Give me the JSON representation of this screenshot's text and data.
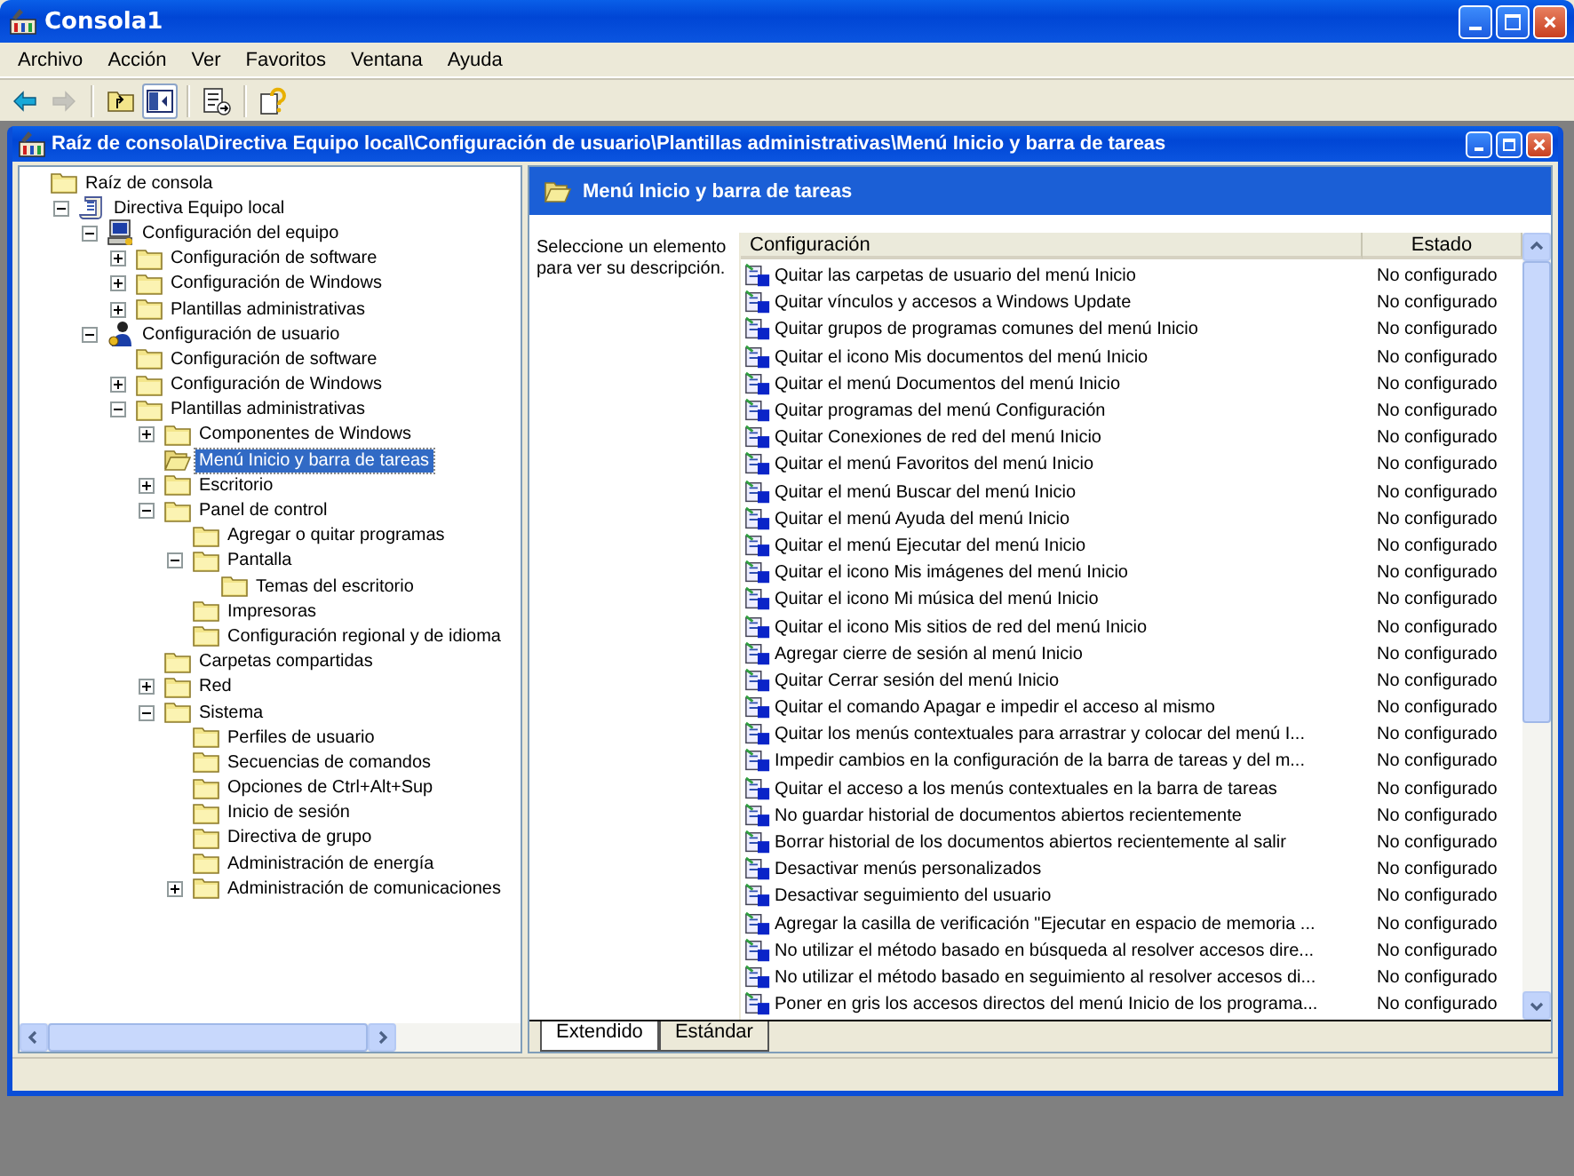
{
  "window": {
    "title": "Consola1"
  },
  "menu": [
    "Archivo",
    "Acción",
    "Ver",
    "Favoritos",
    "Ventana",
    "Ayuda"
  ],
  "toolbar": [
    {
      "kind": "back",
      "disabled": false,
      "pressed": false
    },
    {
      "kind": "forward",
      "disabled": true,
      "pressed": false
    },
    {
      "kind": "up",
      "disabled": false,
      "pressed": false
    },
    {
      "kind": "tree",
      "disabled": false,
      "pressed": true
    },
    {
      "kind": "export",
      "disabled": false,
      "pressed": false
    },
    {
      "kind": "help",
      "disabled": false,
      "pressed": false
    }
  ],
  "console": {
    "title": "Raíz de consola\\Directiva Equipo local\\Configuración de usuario\\Plantillas administrativas\\Menú Inicio y barra de tareas",
    "tree": [
      {
        "label": "Raíz de consola",
        "kind": "folder",
        "selected": false,
        "children": [
          {
            "label": "Directiva Equipo local",
            "kind": "policy",
            "expanded": true,
            "selected": false,
            "children": [
              {
                "label": "Configuración del equipo",
                "kind": "computer",
                "expanded": true,
                "selected": false,
                "children": [
                  {
                    "label": "Configuración de software",
                    "kind": "folder",
                    "expanded": false,
                    "selected": false
                  },
                  {
                    "label": "Configuración de Windows",
                    "kind": "folder",
                    "expanded": false,
                    "selected": false
                  },
                  {
                    "label": "Plantillas administrativas",
                    "kind": "folder",
                    "expanded": false,
                    "selected": false
                  }
                ]
              },
              {
                "label": "Configuración de usuario",
                "kind": "user",
                "expanded": true,
                "selected": false,
                "children": [
                  {
                    "label": "Configuración de software",
                    "kind": "folder",
                    "selected": false
                  },
                  {
                    "label": "Configuración de Windows",
                    "kind": "folder",
                    "expanded": false,
                    "selected": false
                  },
                  {
                    "label": "Plantillas administrativas",
                    "kind": "folder",
                    "expanded": true,
                    "selected": false,
                    "children": [
                      {
                        "label": "Componentes de Windows",
                        "kind": "folder",
                        "expanded": false,
                        "selected": false
                      },
                      {
                        "label": "Menú Inicio y barra de tareas",
                        "kind": "folder",
                        "selected": true
                      },
                      {
                        "label": "Escritorio",
                        "kind": "folder",
                        "expanded": false,
                        "selected": false
                      },
                      {
                        "label": "Panel de control",
                        "kind": "folder",
                        "expanded": true,
                        "selected": false,
                        "children": [
                          {
                            "label": "Agregar o quitar programas",
                            "kind": "folder",
                            "selected": false
                          },
                          {
                            "label": "Pantalla",
                            "kind": "folder",
                            "expanded": true,
                            "selected": false,
                            "children": [
                              {
                                "label": "Temas del escritorio",
                                "kind": "folder",
                                "selected": false
                              }
                            ]
                          },
                          {
                            "label": "Impresoras",
                            "kind": "folder",
                            "selected": false
                          },
                          {
                            "label": "Configuración regional y de idioma",
                            "kind": "folder",
                            "selected": false
                          }
                        ]
                      },
                      {
                        "label": "Carpetas compartidas",
                        "kind": "folder",
                        "selected": false
                      },
                      {
                        "label": "Red",
                        "kind": "folder",
                        "expanded": false,
                        "selected": false
                      },
                      {
                        "label": "Sistema",
                        "kind": "folder",
                        "expanded": true,
                        "selected": false,
                        "children": [
                          {
                            "label": "Perfiles de usuario",
                            "kind": "folder",
                            "selected": false
                          },
                          {
                            "label": "Secuencias de comandos",
                            "kind": "folder",
                            "selected": false
                          },
                          {
                            "label": "Opciones de Ctrl+Alt+Sup",
                            "kind": "folder",
                            "selected": false
                          },
                          {
                            "label": "Inicio de sesión",
                            "kind": "folder",
                            "selected": false
                          },
                          {
                            "label": "Directiva de grupo",
                            "kind": "folder",
                            "selected": false
                          },
                          {
                            "label": "Administración de energía",
                            "kind": "folder",
                            "selected": false
                          },
                          {
                            "label": "Administración de comunicaciones",
                            "kind": "folder",
                            "expanded": false,
                            "selected": false
                          }
                        ]
                      }
                    ]
                  }
                ]
              }
            ]
          }
        ]
      }
    ],
    "panel": {
      "title": "Menú Inicio y barra de tareas",
      "description": "Seleccione un elemento para ver su descripción.",
      "columns": [
        "Configuración",
        "Estado"
      ],
      "rows": [
        {
          "setting": "Quitar las carpetas de usuario del menú Inicio",
          "state": "No configurado"
        },
        {
          "setting": "Quitar vínculos y accesos a Windows Update",
          "state": "No configurado"
        },
        {
          "setting": "Quitar grupos de programas comunes del menú Inicio",
          "state": "No configurado"
        },
        {
          "setting": "Quitar el icono Mis documentos del menú Inicio",
          "state": "No configurado"
        },
        {
          "setting": "Quitar el menú Documentos del menú Inicio",
          "state": "No configurado"
        },
        {
          "setting": "Quitar programas del menú Configuración",
          "state": "No configurado"
        },
        {
          "setting": "Quitar Conexiones de red del menú Inicio",
          "state": "No configurado"
        },
        {
          "setting": "Quitar el menú Favoritos del menú Inicio",
          "state": "No configurado"
        },
        {
          "setting": "Quitar el menú Buscar del menú Inicio",
          "state": "No configurado"
        },
        {
          "setting": "Quitar el menú Ayuda del menú Inicio",
          "state": "No configurado"
        },
        {
          "setting": "Quitar el menú Ejecutar del menú Inicio",
          "state": "No configurado"
        },
        {
          "setting": "Quitar el icono Mis imágenes del menú Inicio",
          "state": "No configurado"
        },
        {
          "setting": "Quitar el icono Mi música del menú Inicio",
          "state": "No configurado"
        },
        {
          "setting": "Quitar el icono Mis sitios de red del menú Inicio",
          "state": "No configurado"
        },
        {
          "setting": "Agregar cierre de sesión al menú Inicio",
          "state": "No configurado"
        },
        {
          "setting": "Quitar Cerrar sesión del menú Inicio",
          "state": "No configurado"
        },
        {
          "setting": " Quitar el comando Apagar e impedir el acceso al mismo",
          "state": "No configurado"
        },
        {
          "setting": "Quitar los menús contextuales para arrastrar y colocar del menú I...",
          "state": "No configurado"
        },
        {
          "setting": "Impedir cambios en la configuración de la barra de tareas y del m...",
          "state": "No configurado"
        },
        {
          "setting": "Quitar el acceso a los menús contextuales en la barra de tareas",
          "state": "No configurado"
        },
        {
          "setting": "No guardar historial de documentos abiertos recientemente",
          "state": "No configurado"
        },
        {
          "setting": "Borrar historial de los documentos abiertos recientemente al salir",
          "state": "No configurado"
        },
        {
          "setting": "Desactivar menús personalizados",
          "state": "No configurado"
        },
        {
          "setting": "Desactivar seguimiento del usuario",
          "state": "No configurado"
        },
        {
          "setting": "Agregar la casilla de verificación \"Ejecutar en espacio de memoria ...",
          "state": "No configurado"
        },
        {
          "setting": "No utilizar el método basado en búsqueda al resolver accesos dire...",
          "state": "No configurado"
        },
        {
          "setting": "No utilizar el método basado en seguimiento al resolver accesos di...",
          "state": "No configurado"
        },
        {
          "setting": "Poner en gris los accesos directos del menú Inicio de los programa...",
          "state": "No configurado"
        }
      ],
      "tabs": [
        {
          "label": "Extendido",
          "selected": true
        },
        {
          "label": "Estándar",
          "selected": false
        }
      ]
    }
  }
}
